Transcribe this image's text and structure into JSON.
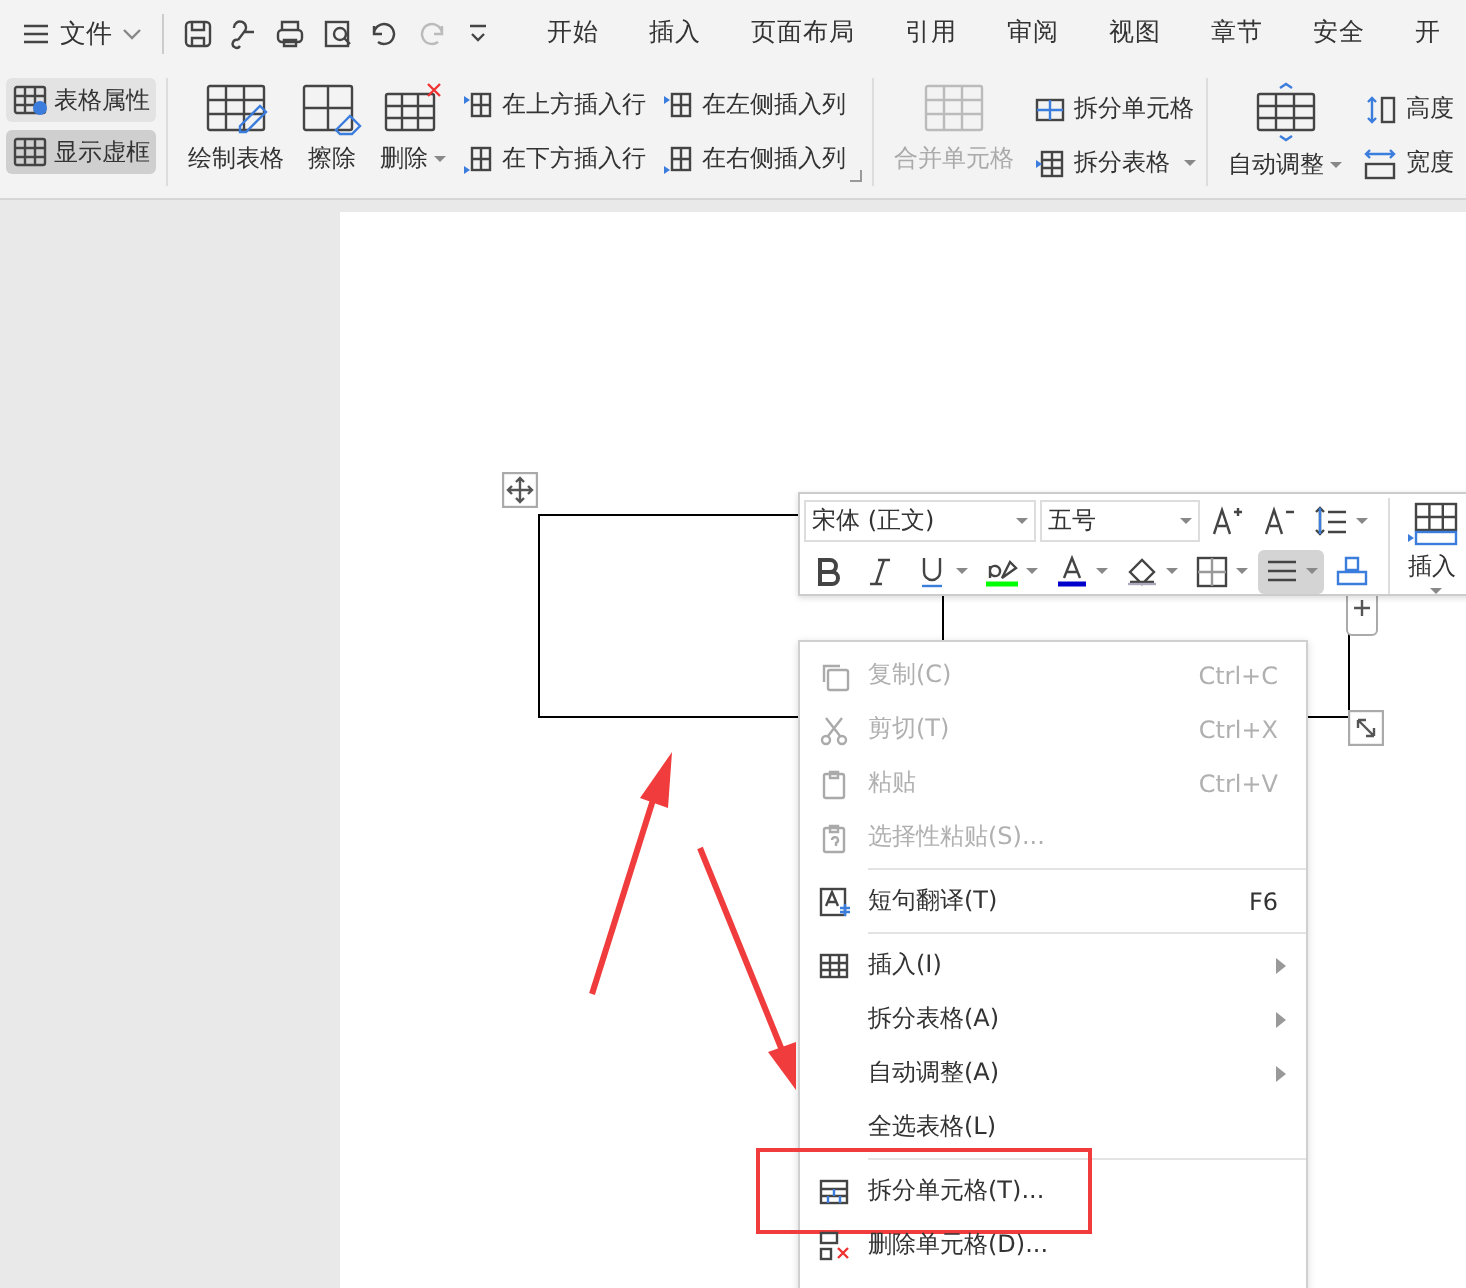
{
  "menu_bar": {
    "file_menu": "文件",
    "tabs": [
      {
        "label": "开始",
        "selected": false
      },
      {
        "label": "插入",
        "selected": false
      },
      {
        "label": "页面布局",
        "selected": false
      },
      {
        "label": "引用",
        "selected": false
      },
      {
        "label": "审阅",
        "selected": false
      },
      {
        "label": "视图",
        "selected": false
      },
      {
        "label": "章节",
        "selected": false
      },
      {
        "label": "安全",
        "selected": false
      },
      {
        "label": "开",
        "selected": false
      }
    ]
  },
  "ribbon": {
    "toggles": [
      {
        "label": "表格属性",
        "on": false
      },
      {
        "label": "显示虚框",
        "on": true
      }
    ],
    "large_buttons": [
      {
        "label": "绘制表格",
        "dropdown": false
      },
      {
        "label": "擦除",
        "dropdown": false
      },
      {
        "label": "删除",
        "dropdown": true
      }
    ],
    "insert_buttons": [
      {
        "label": "在上方插入行"
      },
      {
        "label": "在下方插入行"
      },
      {
        "label": "在左侧插入列"
      },
      {
        "label": "在右侧插入列"
      }
    ],
    "merge_button": {
      "label": "合并单元格",
      "disabled": true
    },
    "split_buttons": [
      {
        "label": "拆分单元格",
        "dropdown": false
      },
      {
        "label": "拆分表格",
        "dropdown": true
      }
    ],
    "autofit_button": {
      "label": "自动调整",
      "dropdown": true
    },
    "size_labels": [
      {
        "label": "高度"
      },
      {
        "label": "宽度"
      }
    ]
  },
  "floating_toolbar": {
    "font": "宋体 (正文)",
    "size": "五号",
    "insert_label": "插入",
    "align_selected": true
  },
  "context_menu": [
    {
      "kind": "item",
      "label": "复制(C)",
      "shortcut": "Ctrl+C",
      "disabled": true,
      "submenu": false,
      "highlighted": false
    },
    {
      "kind": "item",
      "label": "剪切(T)",
      "shortcut": "Ctrl+X",
      "disabled": true,
      "submenu": false,
      "highlighted": false
    },
    {
      "kind": "item",
      "label": "粘贴",
      "shortcut": "Ctrl+V",
      "disabled": true,
      "submenu": false,
      "highlighted": false
    },
    {
      "kind": "item",
      "label": "选择性粘贴(S)...",
      "disabled": true,
      "submenu": false,
      "highlighted": false
    },
    {
      "kind": "separator"
    },
    {
      "kind": "item",
      "label": "短句翻译(T)",
      "shortcut": "F6",
      "disabled": false,
      "submenu": false,
      "highlighted": false
    },
    {
      "kind": "separator"
    },
    {
      "kind": "item",
      "label": "插入(I)",
      "disabled": false,
      "submenu": true,
      "highlighted": false
    },
    {
      "kind": "item",
      "label": "拆分表格(A)",
      "disabled": false,
      "submenu": true,
      "highlighted": false
    },
    {
      "kind": "item",
      "label": "自动调整(A)",
      "disabled": false,
      "submenu": true,
      "highlighted": false
    },
    {
      "kind": "item",
      "label": "全选表格(L)",
      "disabled": false,
      "submenu": false,
      "highlighted": false
    },
    {
      "kind": "separator"
    },
    {
      "kind": "item",
      "label": "拆分单元格(T)...",
      "disabled": false,
      "submenu": false,
      "highlighted": true
    },
    {
      "kind": "item",
      "label": "删除单元格(D)...",
      "disabled": false,
      "submenu": false,
      "highlighted": false
    }
  ]
}
